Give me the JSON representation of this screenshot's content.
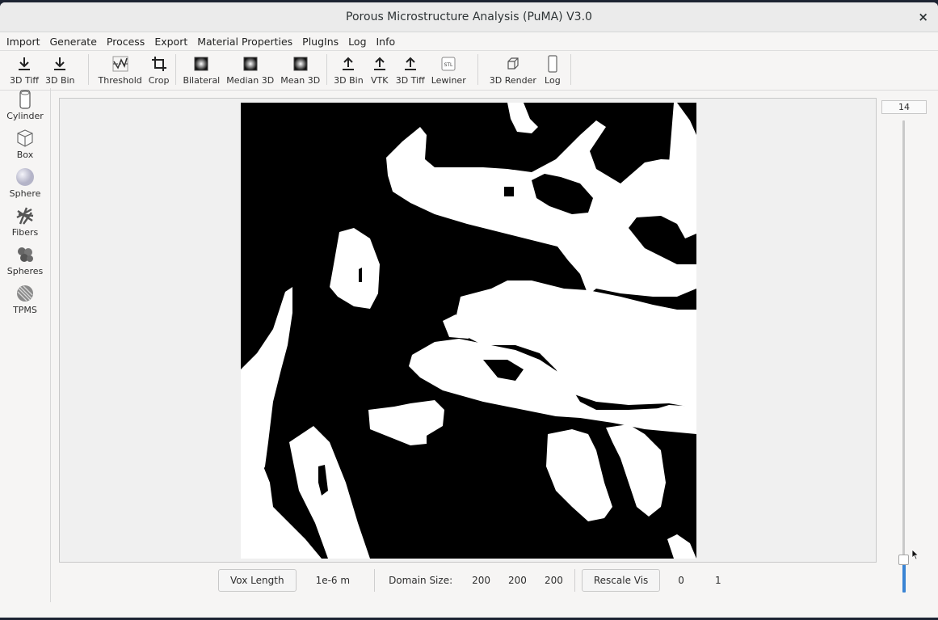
{
  "window": {
    "title": "Porous Microstructure Analysis (PuMA) V3.0",
    "close_glyph": "×"
  },
  "menu": [
    "Import",
    "Generate",
    "Process",
    "Export",
    "Material Properties",
    "PlugIns",
    "Log",
    "Info"
  ],
  "toolbar": {
    "import_tiff": "3D Tiff",
    "import_bin": "3D Bin",
    "threshold": "Threshold",
    "crop": "Crop",
    "bilateral": "Bilateral",
    "median": "Median 3D",
    "mean": "Mean 3D",
    "export_bin": "3D Bin",
    "export_vtk": "VTK",
    "export_tiff": "3D Tiff",
    "lewiner": "Lewiner",
    "lewiner_icon_text": "STL",
    "render": "3D Render",
    "log": "Log"
  },
  "sidebar": [
    "Cylinder",
    "Box",
    "Sphere",
    "Fibers",
    "Spheres",
    "TPMS"
  ],
  "slider": {
    "value": "14",
    "fraction": 0.07
  },
  "bottom": {
    "vox_length_button": "Vox Length",
    "vox_length_value": "1e-6 m",
    "domain_label": "Domain Size:",
    "domain_x": "200",
    "domain_y": "200",
    "domain_z": "200",
    "rescale_button": "Rescale Vis",
    "vis_min": "0",
    "vis_max": "1"
  },
  "colors": {
    "accent": "#3a84d4",
    "solid_phase": "#ffffff",
    "void_phase": "#000000"
  }
}
